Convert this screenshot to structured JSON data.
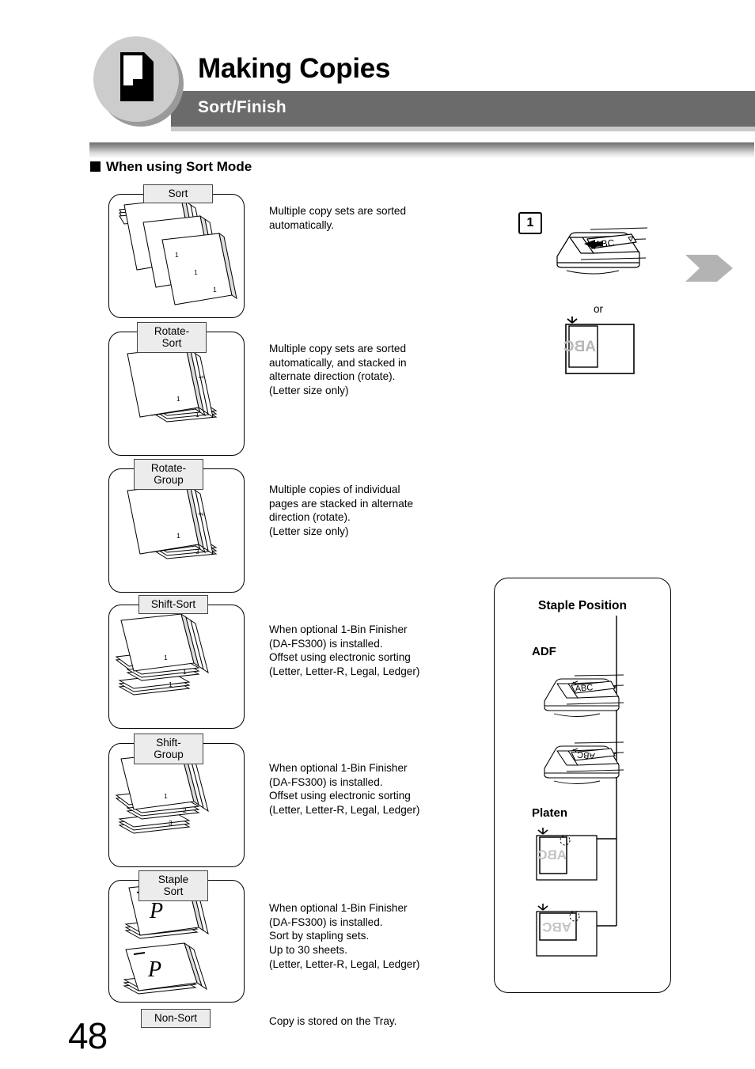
{
  "header": {
    "chapter_title": "Making Copies",
    "section_title": "Sort/Finish",
    "icon": "page-corner-fold-icon",
    "band_color": "#6b6b6b",
    "circle_color": "#cccccc"
  },
  "subsection": {
    "marker": "square-bullet-icon",
    "title": "When using Sort Mode"
  },
  "modes": [
    {
      "label": "Sort",
      "description": "Multiple copy sets are sorted\nautomatically.",
      "art": "three-sorted-stacks",
      "sheet_numbers": [
        "1",
        "1",
        "1"
      ]
    },
    {
      "label": "Rotate-Sort",
      "description": "Multiple copy sets are sorted\nautomatically, and stacked in\nalternate direction (rotate).\n(Letter size only)",
      "art": "rotated-stacks",
      "sheet_numbers": [
        "1",
        "1",
        "1"
      ]
    },
    {
      "label": "Rotate-Group",
      "description": "Multiple copies of individual\npages are stacked in alternate\ndirection (rotate).\n(Letter size only)",
      "art": "rotated-group-stacks",
      "sheet_numbers": [
        "1",
        "2",
        "3"
      ]
    },
    {
      "label": "Shift-Sort",
      "description": "When optional 1-Bin Finisher\n(DA-FS300) is installed.\nOffset using electronic sorting\n(Letter, Letter-R, Legal, Ledger)",
      "art": "shifted-stacks",
      "sheet_numbers": [
        "1",
        "1",
        "1"
      ]
    },
    {
      "label": "Shift-Group",
      "description": "When optional 1-Bin Finisher\n(DA-FS300) is installed.\nOffset using electronic sorting\n(Letter, Letter-R, Legal, Ledger)",
      "art": "shifted-group-stacks",
      "sheet_numbers": [
        "1",
        "2",
        "3"
      ]
    },
    {
      "label": "Staple Sort",
      "description": "When optional 1-Bin Finisher\n(DA-FS300) is installed.\nSort by stapling sets.\nUp to 30 sheets.\n(Letter, Letter-R, Legal, Ledger)",
      "art": "stapled-p-stacks",
      "sheet_letters": [
        "P",
        "P"
      ]
    }
  ],
  "non_sort": {
    "label": "Non-Sort",
    "description": "Copy is stored on the Tray."
  },
  "step_one": {
    "number": "1",
    "adf_document_text": "ABC",
    "or_label": "or",
    "platen_document_text": "ABC",
    "arrow": "right-chevron-arrow-icon"
  },
  "staple_position_panel": {
    "title": "Staple Position",
    "adf_label": "ADF",
    "platen_label": "Platen",
    "adf_document_text_1": "ABC",
    "adf_document_text_2": "ABC",
    "platen_document_text_1": "ABC",
    "platen_document_text_2": "ABC"
  },
  "page_number": "48"
}
